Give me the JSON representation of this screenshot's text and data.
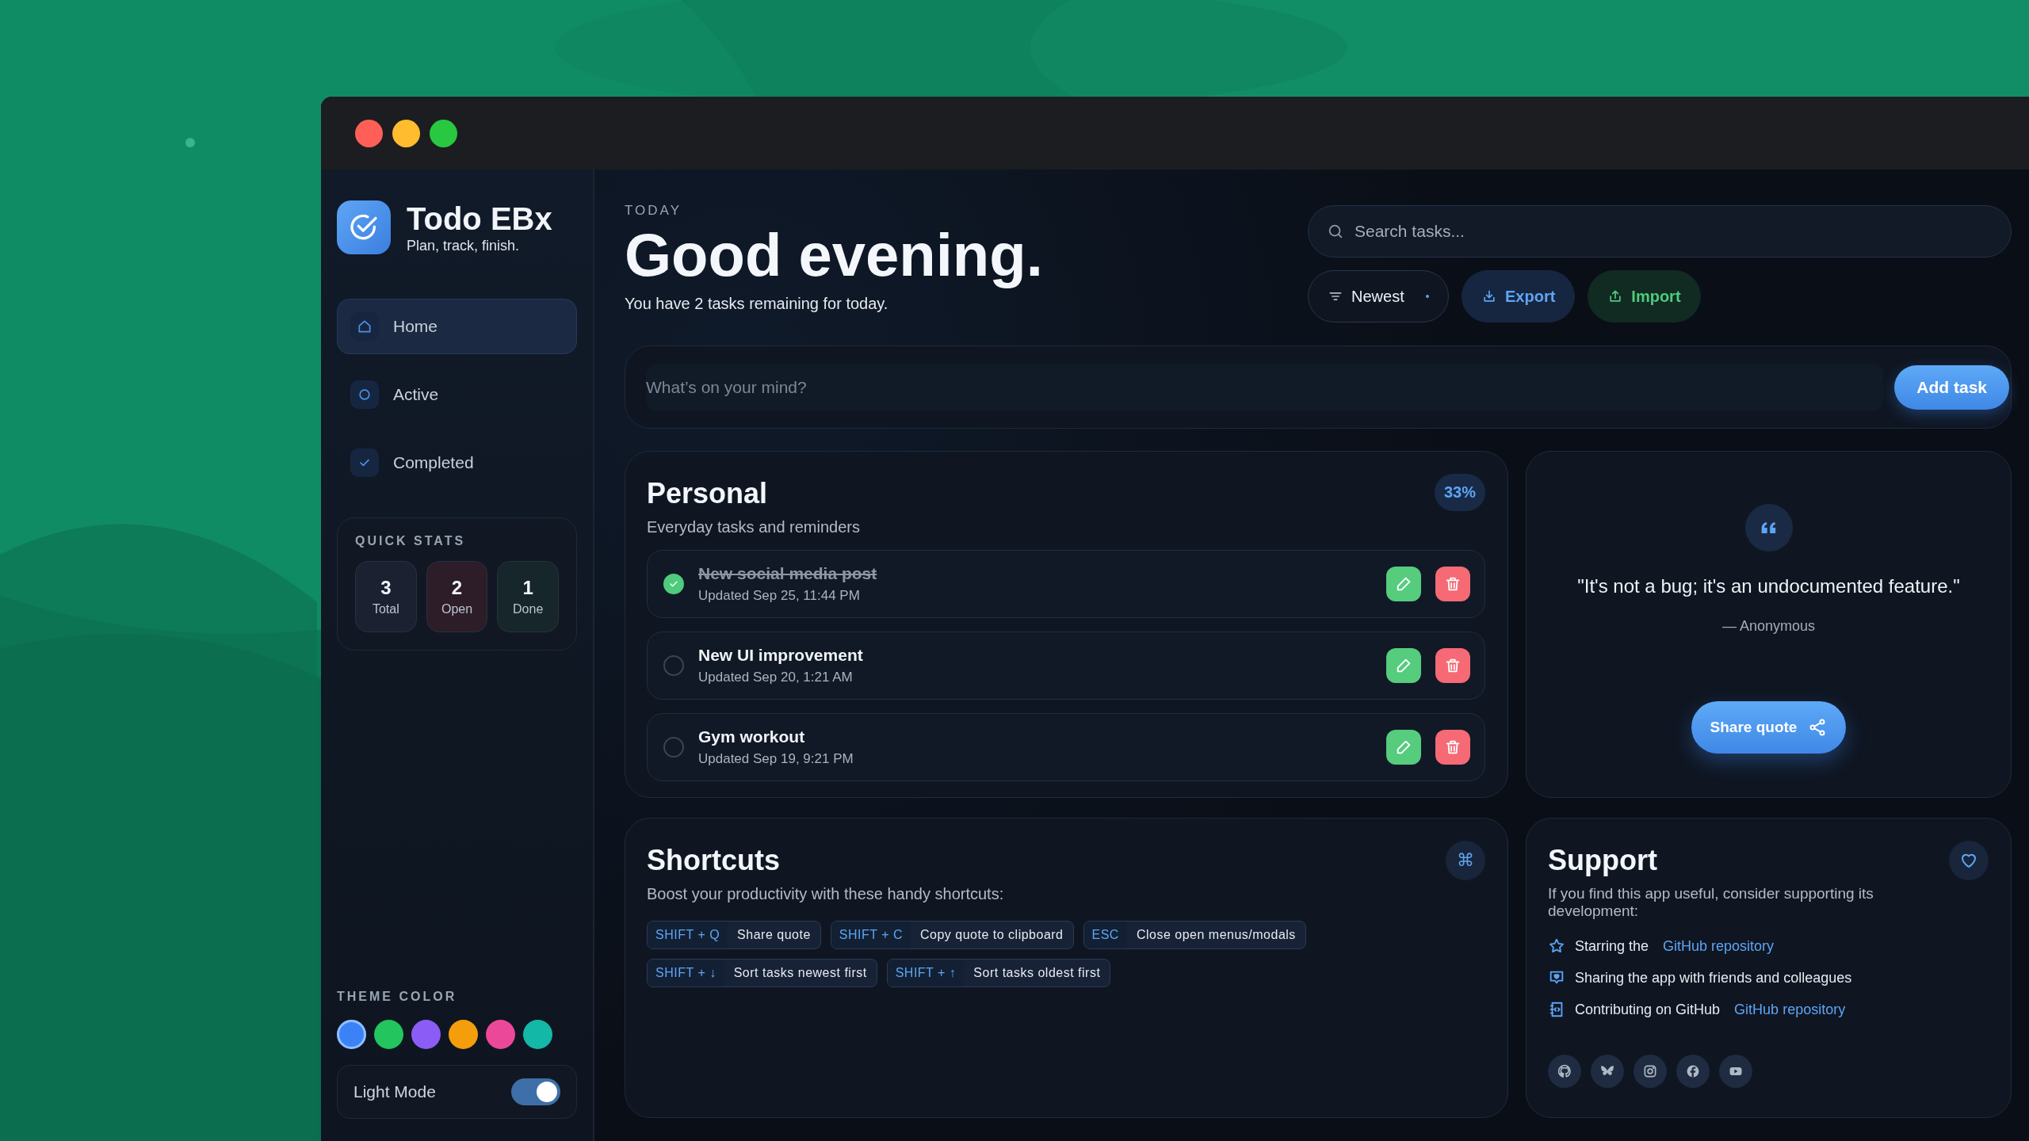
{
  "window": {
    "controls": [
      {
        "kind": "close"
      },
      {
        "kind": "minimize"
      },
      {
        "kind": "maximize"
      }
    ]
  },
  "sidebar": {
    "app_name": "Todo EBx",
    "tagline": "Plan, track, finish.",
    "nav": [
      {
        "label": "Home",
        "selected": true
      },
      {
        "label": "Active",
        "selected": false
      },
      {
        "label": "Completed",
        "selected": false
      }
    ],
    "quick_stats": {
      "title": "QUICK STATS",
      "stats": [
        {
          "value": "3",
          "label": "Total",
          "kind": "total"
        },
        {
          "value": "2",
          "label": "Open",
          "kind": "open"
        },
        {
          "value": "1",
          "label": "Done",
          "kind": "done"
        }
      ]
    },
    "theme": {
      "title": "THEME COLOR",
      "swatches": [
        {
          "color": "#3b82f6",
          "selected": true
        },
        {
          "color": "#22c55e",
          "selected": false
        },
        {
          "color": "#8b5cf6",
          "selected": false
        },
        {
          "color": "#f59e0b",
          "selected": false
        },
        {
          "color": "#ec4899",
          "selected": false
        },
        {
          "color": "#14b8a6",
          "selected": false
        }
      ],
      "mode_label": "Light Mode",
      "mode_on": true
    }
  },
  "header": {
    "eyebrow": "TODAY",
    "greeting": "Good evening.",
    "summary": "You have 2 tasks remaining for today."
  },
  "search": {
    "placeholder": "Search tasks..."
  },
  "sort": {
    "label": "Newest"
  },
  "actions": [
    {
      "label": "Export",
      "kind": "export"
    },
    {
      "label": "Import",
      "kind": "import"
    }
  ],
  "composer": {
    "placeholder": "What’s on your mind?",
    "button": "Add task"
  },
  "personal": {
    "title": "Personal",
    "subtitle": "Everyday tasks and reminders",
    "progress": "33%",
    "tasks": [
      {
        "title": "New social media post",
        "updated": "Updated Sep 25, 11:44 PM",
        "checked": true
      },
      {
        "title": "New UI improvement",
        "updated": "Updated Sep 20, 1:21 AM",
        "checked": false
      },
      {
        "title": "Gym workout",
        "updated": "Updated Sep 19, 9:21 PM",
        "checked": false
      }
    ]
  },
  "quote": {
    "text": "\"It's not a bug; it's an undocumented feature.\"",
    "author": "— Anonymous",
    "button": "Share quote"
  },
  "shortcuts": {
    "title": "Shortcuts",
    "icon": "⌘",
    "subtitle": "Boost your productivity with these handy shortcuts:",
    "items": [
      {
        "keys": "SHIFT + Q",
        "action": "Share quote"
      },
      {
        "keys": "SHIFT + C",
        "action": "Copy quote to clipboard"
      },
      {
        "keys": "ESC",
        "action": "Close open menus/modals"
      },
      {
        "keys": "SHIFT + ↓",
        "action": "Sort tasks newest first"
      },
      {
        "keys": "SHIFT + ↑",
        "action": "Sort tasks oldest first"
      }
    ]
  },
  "support": {
    "title": "Support",
    "intro": "If you find this app useful, consider supporting its development:",
    "items": [
      {
        "text": "Starring the",
        "link": "GitHub repository"
      },
      {
        "text": "Sharing the app with friends and colleagues"
      },
      {
        "text": "Contributing on GitHub",
        "link": "GitHub repository"
      }
    ]
  }
}
